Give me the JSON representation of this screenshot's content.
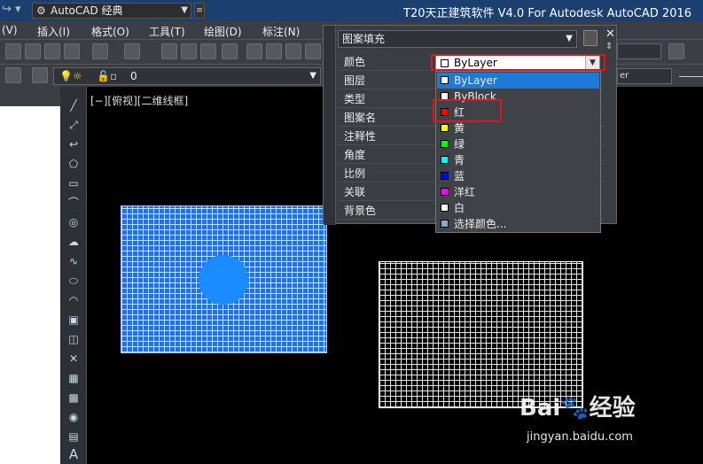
{
  "titlebar": {
    "workspace": "AutoCAD 经典",
    "title": "T20天正建筑软件 V4.0 For Autodesk AutoCAD 2016"
  },
  "menubar": {
    "items": [
      "(V)",
      "插入(I)",
      "格式(O)",
      "工具(T)",
      "绘图(D)",
      "标注(N)"
    ]
  },
  "toolbar2": {
    "layer_value": "0"
  },
  "viewport": {
    "label": "[−][俯视][二维线框]"
  },
  "panel": {
    "title": "图案填充",
    "properties": [
      "颜色",
      "图层",
      "类型",
      "图案名",
      "注释性",
      "角度",
      "比例",
      "关联",
      "背景色"
    ],
    "color_value": "ByLayer"
  },
  "color_dropdown": {
    "options": [
      {
        "label": "ByLayer",
        "swatch": "#ffffff",
        "selected": true
      },
      {
        "label": "ByBlock",
        "swatch": "#ffffff",
        "selected": false
      },
      {
        "label": "红",
        "swatch": "#ff0000",
        "selected": false
      },
      {
        "label": "黄",
        "swatch": "#ffff00",
        "selected": false
      },
      {
        "label": "绿",
        "swatch": "#00ff00",
        "selected": false
      },
      {
        "label": "青",
        "swatch": "#00ffff",
        "selected": false
      },
      {
        "label": "蓝",
        "swatch": "#0000ff",
        "selected": false
      },
      {
        "label": "洋红",
        "swatch": "#ff00ff",
        "selected": false
      },
      {
        "label": "白",
        "swatch": "#ffffff",
        "selected": false
      },
      {
        "label": "选择颜色...",
        "swatch": "#88aacc",
        "selected": false
      }
    ]
  },
  "right_toolbar": {
    "combo_text": "er"
  },
  "watermark": {
    "brand": "Bai",
    "suffix": "经验",
    "url": "jingyan.baidu.com"
  },
  "colors": {
    "highlight_box": "#e0141c",
    "selection": "#1e7ad6",
    "hatch_fill": "#2b6fd6"
  }
}
